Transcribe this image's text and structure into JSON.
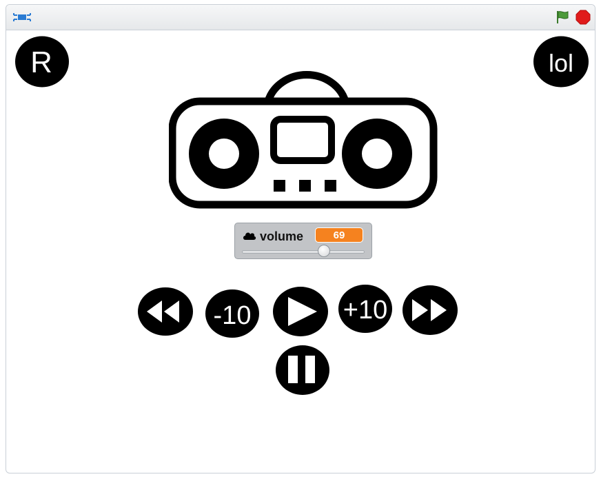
{
  "topbar": {
    "fullscreen_icon": "fullscreen-icon",
    "green_flag_icon": "green-flag-icon",
    "stop_icon": "stop-icon",
    "colors": {
      "flag": "#3a7a2a",
      "stop": "#e01b1b",
      "fullscreen": "#2a7bd3"
    }
  },
  "sprites": {
    "reset_text": "R",
    "lol_text": "lol"
  },
  "monitor": {
    "label": "volume",
    "value": "69",
    "slider_fraction": 0.69,
    "icon": "cloud-icon"
  },
  "controls": {
    "minus10": "-10",
    "plus10": "+10",
    "rewind_icon": "rewind-icon",
    "play_icon": "play-icon",
    "fast_forward_icon": "fast-forward-icon",
    "pause_icon": "pause-icon"
  }
}
